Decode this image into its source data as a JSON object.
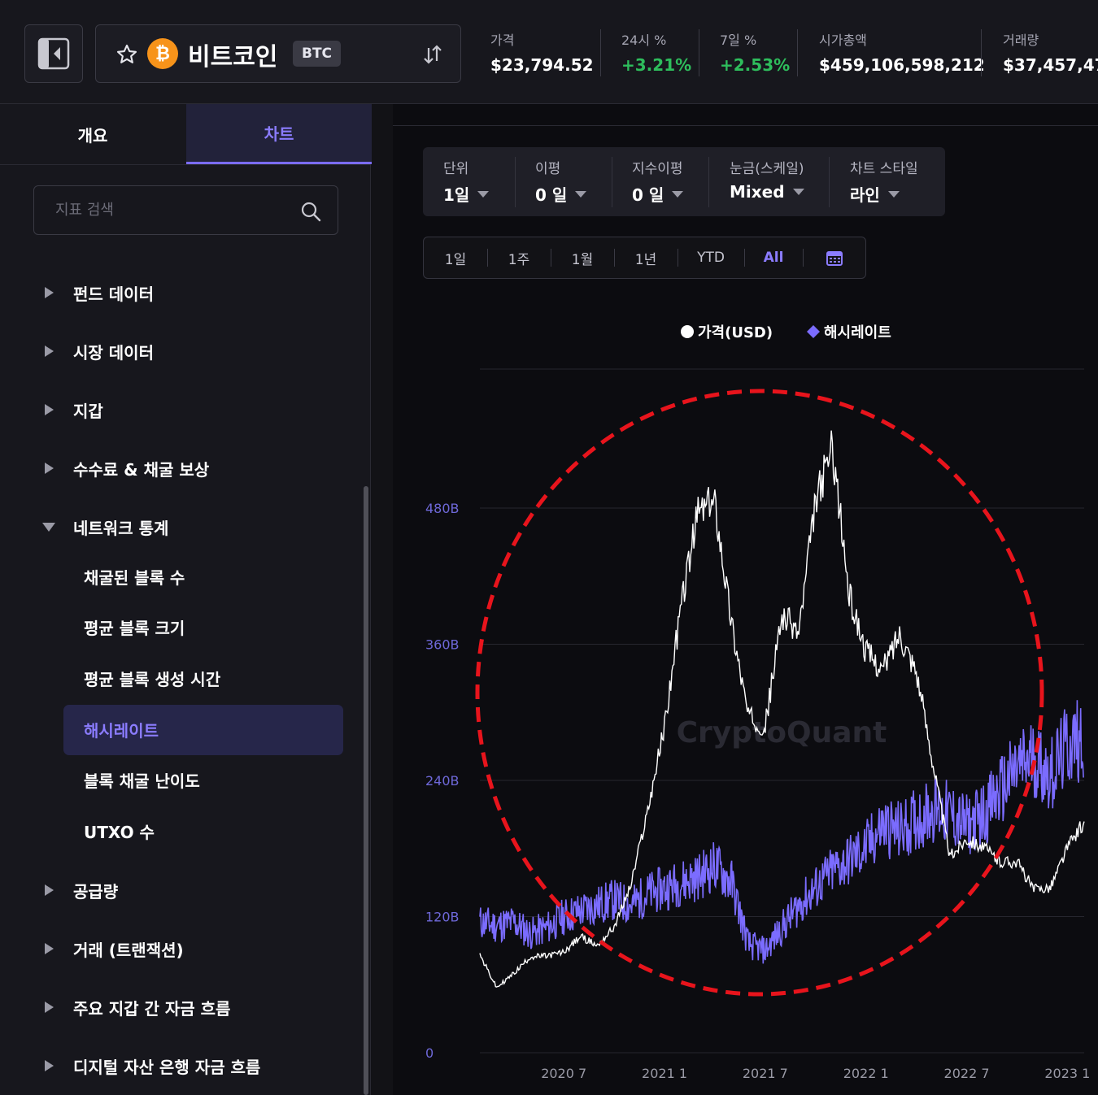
{
  "header": {
    "coin_name": "비트코인",
    "coin_symbol": "BTC",
    "coin_logo_glyph": "₿",
    "stats": [
      {
        "label": "가격",
        "value": "$23,794.52",
        "trend": "neutral"
      },
      {
        "label": "24시 %",
        "value": "+3.21%",
        "trend": "up"
      },
      {
        "label": "7일 %",
        "value": "+2.53%",
        "trend": "up"
      },
      {
        "label": "시가총액",
        "value": "$459,106,598,212",
        "trend": "neutral"
      },
      {
        "label": "거래량",
        "value": "$37,457,478",
        "trend": "neutral"
      }
    ]
  },
  "sidebar": {
    "tabs": [
      "개요",
      "차트"
    ],
    "active_tab": 1,
    "search_placeholder": "지표 검색",
    "groups": [
      {
        "label": "펀드 데이터",
        "expanded": false
      },
      {
        "label": "시장 데이터",
        "expanded": false
      },
      {
        "label": "지갑",
        "expanded": false
      },
      {
        "label": "수수료 & 채굴 보상",
        "expanded": false
      },
      {
        "label": "네트워크 통계",
        "expanded": true
      },
      {
        "label": "공급량",
        "expanded": false
      },
      {
        "label": "거래 (트랜잭션)",
        "expanded": false
      },
      {
        "label": "주요 지갑 간 자금 흐름",
        "expanded": false
      },
      {
        "label": "디지털 자산 은행 자금 흐름",
        "expanded": false
      }
    ],
    "network_items": [
      "채굴된 블록 수",
      "평균 블록 크기",
      "평균 블록 생성 시간",
      "해시레이트",
      "블록 채굴 난이도",
      "UTXO 수"
    ],
    "active_network_item": 3
  },
  "options": [
    {
      "label": "단위",
      "value": "1일"
    },
    {
      "label": "이평",
      "value": "0 일"
    },
    {
      "label": "지수이평",
      "value": "0 일"
    },
    {
      "label": "눈금(스케일)",
      "value": "Mixed"
    },
    {
      "label": "차트 스타일",
      "value": "라인"
    }
  ],
  "ranges": [
    "1일",
    "1주",
    "1월",
    "1년",
    "YTD",
    "All"
  ],
  "active_range": "All",
  "watermark": "CryptoQuant",
  "colors": {
    "accent": "#7b6cff",
    "price_line": "#ffffff",
    "hashrate_line": "#7b6cff",
    "up": "#2ebd5c",
    "annotation_circle": "#e8141c",
    "coin_logo": "#f7931a"
  },
  "chart_data": {
    "type": "line",
    "legend": [
      "가격(USD)",
      "해시레이트"
    ],
    "legend_placement": "top-center",
    "y_ticks": [
      "0",
      "120B",
      "240B",
      "360B",
      "480B"
    ],
    "ylim": [
      0,
      480
    ],
    "x_ticks": [
      "2020 7",
      "2021 1",
      "2021 7",
      "2022 1",
      "2022 7",
      "2023 1"
    ],
    "grid": true,
    "annotation": "red dashed circle around main chart area",
    "series": [
      {
        "name": "가격(USD)",
        "axis": "unlabeled price scale",
        "x": [
          "2020-02",
          "2020-03",
          "2020-04",
          "2020-05",
          "2020-06",
          "2020-07",
          "2020-08",
          "2020-09",
          "2020-10",
          "2020-11",
          "2020-12",
          "2021-01",
          "2021-02",
          "2021-03",
          "2021-04",
          "2021-05",
          "2021-06",
          "2021-07",
          "2021-08",
          "2021-09",
          "2021-10",
          "2021-11",
          "2021-12",
          "2022-01",
          "2022-02",
          "2022-03",
          "2022-04",
          "2022-05",
          "2022-06",
          "2022-07",
          "2022-08",
          "2022-09",
          "2022-10",
          "2022-11",
          "2022-12",
          "2023-01",
          "2023-02"
        ],
        "values": [
          9500,
          6000,
          7500,
          9300,
          9400,
          9800,
          11500,
          10500,
          12500,
          17000,
          25000,
          34000,
          47000,
          57000,
          58000,
          45000,
          35000,
          34000,
          46000,
          44000,
          58000,
          64000,
          48000,
          42000,
          40000,
          44000,
          40000,
          30000,
          20000,
          22000,
          21000,
          19500,
          19500,
          16500,
          16800,
          21000,
          23800
        ]
      },
      {
        "name": "해시레이트",
        "unit": "H/s",
        "x": [
          "2020-02",
          "2020-03",
          "2020-04",
          "2020-05",
          "2020-06",
          "2020-07",
          "2020-08",
          "2020-09",
          "2020-10",
          "2020-11",
          "2020-12",
          "2021-01",
          "2021-02",
          "2021-03",
          "2021-04",
          "2021-05",
          "2021-06",
          "2021-07",
          "2021-08",
          "2021-09",
          "2021-10",
          "2021-11",
          "2021-12",
          "2022-01",
          "2022-02",
          "2022-03",
          "2022-04",
          "2022-05",
          "2022-06",
          "2022-07",
          "2022-08",
          "2022-09",
          "2022-10",
          "2022-11",
          "2022-12",
          "2023-01",
          "2023-02"
        ],
        "values": [
          115,
          112,
          115,
          105,
          110,
          120,
          125,
          130,
          135,
          130,
          140,
          145,
          150,
          155,
          165,
          150,
          95,
          90,
          110,
          130,
          145,
          160,
          170,
          180,
          200,
          195,
          205,
          215,
          210,
          200,
          210,
          230,
          250,
          260,
          245,
          270,
          280
        ]
      }
    ]
  }
}
